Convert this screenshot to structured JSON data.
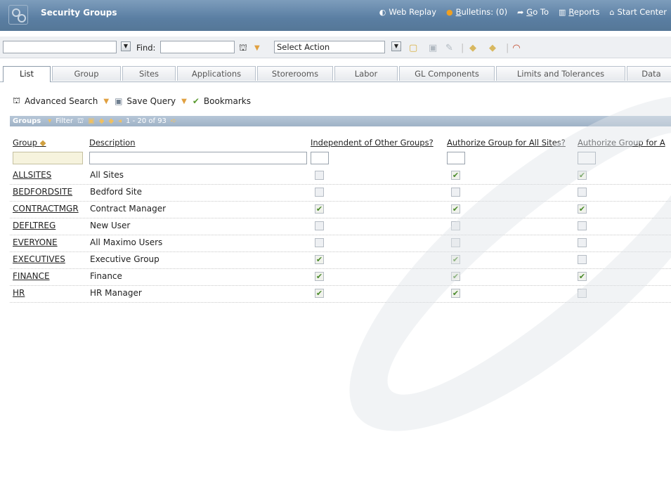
{
  "app": {
    "title": "Security Groups"
  },
  "header_links": [
    {
      "label": "Web Replay",
      "icon": "web-replay-icon"
    },
    {
      "label": "Bulletins: (0)",
      "icon": "bulletin-icon"
    },
    {
      "label": "Go To",
      "icon": "goto-icon"
    },
    {
      "label": "Reports",
      "icon": "reports-icon"
    },
    {
      "label": "Start Center",
      "icon": "home-icon"
    }
  ],
  "toolbar": {
    "find_label": "Find:",
    "select_action": "Select Action"
  },
  "tabs": [
    "List",
    "Group",
    "Sites",
    "Applications",
    "Storerooms",
    "Labor",
    "GL Components",
    "Limits and Tolerances",
    "Data"
  ],
  "actions": {
    "advanced_search": "Advanced Search",
    "save_query": "Save Query",
    "bookmarks": "Bookmarks"
  },
  "table": {
    "title": "Groups",
    "filter_label": "Filter",
    "pagination": "1 - 20 of 93",
    "columns": [
      "Group",
      "Description",
      "Independent of Other Groups?",
      "Authorize Group for All Sites?",
      "Authorize Group for A"
    ],
    "rows": [
      {
        "group": "ALLSITES",
        "description": "All Sites",
        "independent": false,
        "all_sites": true,
        "all_a": true
      },
      {
        "group": "BEDFORDSITE",
        "description": "Bedford Site",
        "independent": false,
        "all_sites": false,
        "all_a": false
      },
      {
        "group": "CONTRACTMGR",
        "description": "Contract Manager",
        "independent": true,
        "all_sites": true,
        "all_a": true
      },
      {
        "group": "DEFLTREG",
        "description": "New User",
        "independent": false,
        "all_sites": false,
        "all_a": false
      },
      {
        "group": "EVERYONE",
        "description": "All Maximo Users",
        "independent": false,
        "all_sites": false,
        "all_a": false
      },
      {
        "group": "EXECUTIVES",
        "description": "Executive Group",
        "independent": true,
        "all_sites": true,
        "all_a": false
      },
      {
        "group": "FINANCE",
        "description": "Finance",
        "independent": true,
        "all_sites": true,
        "all_a": true
      },
      {
        "group": "HR",
        "description": "HR Manager",
        "independent": true,
        "all_sites": true,
        "all_a": false
      }
    ]
  }
}
